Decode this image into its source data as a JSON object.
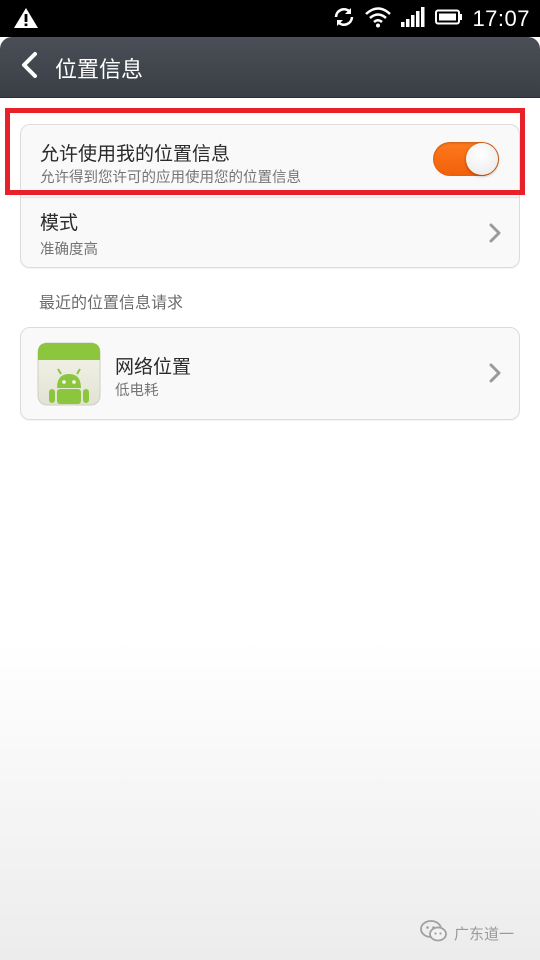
{
  "status_bar": {
    "time": "17:07",
    "icons": [
      "warning-icon",
      "sync-icon",
      "wifi-icon",
      "signal-icon",
      "battery-icon"
    ]
  },
  "header": {
    "title": "位置信息",
    "back_icon": "back-chevron-icon"
  },
  "location_card": {
    "allow": {
      "title": "允许使用我的位置信息",
      "subtitle": "允许得到您许可的应用使用您的位置信息",
      "enabled": true,
      "toggle_color": "#f26a12"
    },
    "mode": {
      "title": "模式",
      "value": "准确度高"
    }
  },
  "recent": {
    "header": "最近的位置信息请求",
    "items": [
      {
        "name": "网络位置",
        "detail": "低电耗",
        "icon": "android-app-icon"
      }
    ]
  },
  "watermark": {
    "text": "广东道一",
    "icon": "wechat-icon"
  },
  "colors": {
    "highlight": "#e8202a",
    "titlebar": "#40444b"
  }
}
